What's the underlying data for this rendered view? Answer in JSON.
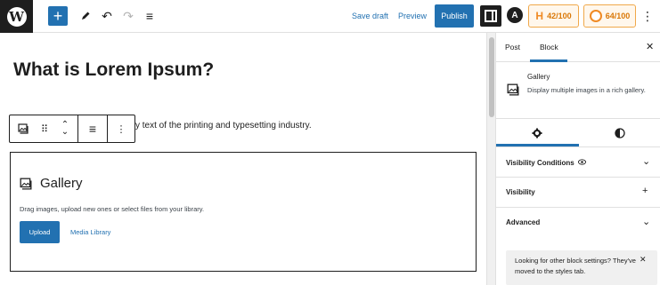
{
  "toolbar": {
    "logo": "W",
    "add_icon": "+",
    "tools_icon": "pencil-icon",
    "undo_icon": "↶",
    "redo_icon": "↷",
    "outline_icon": "≡",
    "save_draft": "Save draft",
    "preview": "Preview",
    "publish": "Publish",
    "astra_icon": "A",
    "seo_score": "42/100",
    "readability_score": "64/100",
    "more_icon": "⋮",
    "accent_color": "#2271b1",
    "score_color": "#f08a24"
  },
  "editor": {
    "title": "What is Lorem Ipsum?",
    "paragraph_visible": "y text of the printing and typesetting industry.",
    "block_toolbar": {
      "block_type_icon": "gallery-icon",
      "drag_icon": "⠿",
      "move_up": "⌃",
      "move_down": "⌄",
      "align_icon": "≡",
      "options_icon": "⋮"
    },
    "gallery": {
      "title": "Gallery",
      "description": "Drag images, upload new ones or select files from your library.",
      "upload": "Upload",
      "media_library": "Media Library"
    }
  },
  "sidebar": {
    "tabs": [
      "Post",
      "Block"
    ],
    "active_tab": "Block",
    "close_icon": "✕",
    "block_card": {
      "title": "Gallery",
      "description": "Display multiple images in a rich gallery."
    },
    "style_tabs": [
      "settings-gear-icon",
      "styles-half-circle-icon"
    ],
    "panels": [
      {
        "label": "Visibility Conditions",
        "control": "⌄"
      },
      {
        "label": "Visibility",
        "control": "+"
      },
      {
        "label": "Advanced",
        "control": "⌄"
      }
    ],
    "notice": {
      "text": "Looking for other block settings? They've moved to the styles tab.",
      "close": "✕"
    }
  }
}
